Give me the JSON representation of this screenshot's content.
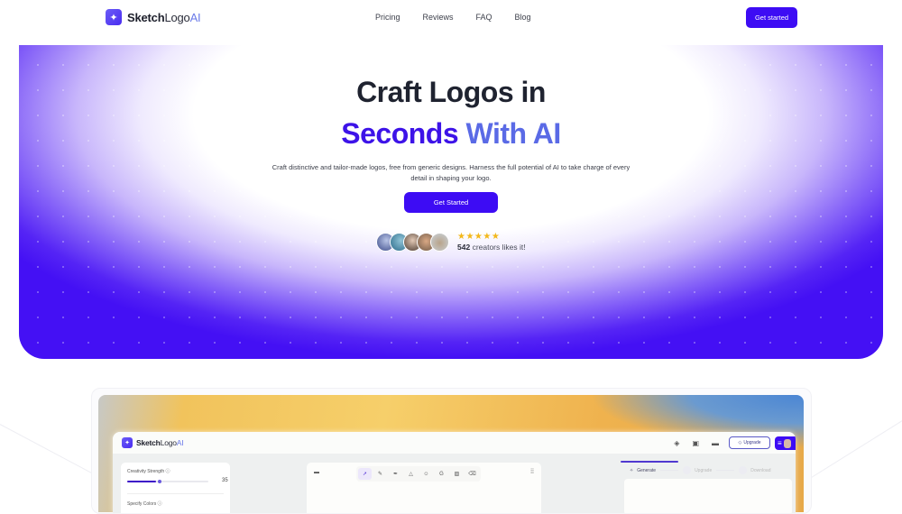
{
  "nav": {
    "brand": {
      "part1": "Sketch",
      "part2": "Logo",
      "part3": "AI"
    },
    "links": [
      "Pricing",
      "Reviews",
      "FAQ",
      "Blog"
    ],
    "cta_label": "Get started"
  },
  "hero": {
    "title_line1": "Craft Logos in",
    "title_line2_a": "Seconds",
    "title_line2_b": "With AI",
    "subtitle": "Craft distinctive and tailor-made logos, free from generic designs. Harness the full potential of AI to take charge of every detail in shaping your logo.",
    "cta_label": "Get Started",
    "rating_stars": 5,
    "stars_glyph": "★★★★★",
    "creator_count": "542",
    "creator_text": "creators likes it!"
  },
  "preview": {
    "app_brand": {
      "part1": "Sketch",
      "part2": "Logo",
      "part3": "AI"
    },
    "header_icons": [
      "cube-icon",
      "image-icon",
      "keyboard-icon"
    ],
    "upgrade_label": "Upgrade",
    "left_panel": {
      "creativity_label": "Creativity Strength",
      "creativity_value": "35",
      "creativity_fraction": 0.35,
      "colors_label": "Specify Colors"
    },
    "tools": [
      "select-tool",
      "pencil-tool",
      "pen-tool",
      "shapes-tool",
      "emoji-tool",
      "text-tool",
      "image-tool",
      "eraser-tool"
    ],
    "steps": [
      "Generate",
      "Upgrade",
      "Download"
    ]
  },
  "colors": {
    "accent": "#3d0cf4",
    "title_dark": "#1f2330",
    "title_purple": "#3d13e8",
    "title_blue": "#5a6ae6",
    "star": "#f3b81a"
  }
}
